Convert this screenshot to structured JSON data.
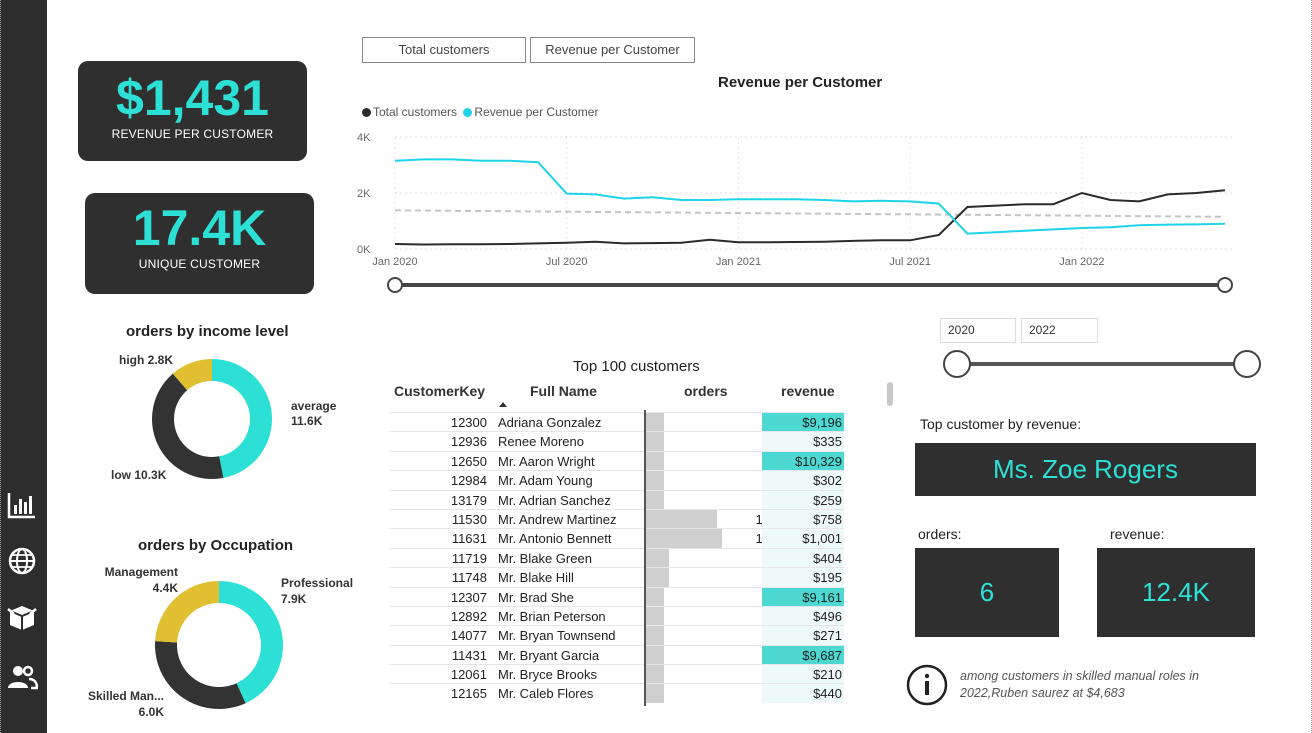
{
  "kpis": {
    "revenue_per_customer": {
      "value": "$1,431",
      "label": "REVENUE PER CUSTOMER"
    },
    "unique_customer": {
      "value": "17.4K",
      "label": "UNIQUE CUSTOMER"
    }
  },
  "toggle_buttons": [
    "Total customers",
    "Revenue per Customer"
  ],
  "line_chart": {
    "title": "Revenue per Customer",
    "legend": [
      "Total customers",
      "Revenue per Customer"
    ],
    "y_ticks": [
      "4K",
      "2K",
      "0K"
    ],
    "x_ticks": [
      "Jan 2020",
      "Jul 2020",
      "Jan 2021",
      "Jul 2021",
      "Jan 2022"
    ]
  },
  "chart_data": {
    "type": "line",
    "x": [
      "2020-01",
      "2020-02",
      "2020-03",
      "2020-04",
      "2020-05",
      "2020-06",
      "2020-07",
      "2020-08",
      "2020-09",
      "2020-10",
      "2020-11",
      "2020-12",
      "2021-01",
      "2021-02",
      "2021-03",
      "2021-04",
      "2021-05",
      "2021-06",
      "2021-07",
      "2021-08",
      "2021-09",
      "2021-10",
      "2021-11",
      "2021-12",
      "2022-01",
      "2022-02",
      "2022-03",
      "2022-04",
      "2022-05",
      "2022-06"
    ],
    "series": [
      {
        "name": "Total customers",
        "color": "#2b2b2b",
        "values": [
          180,
          160,
          170,
          170,
          180,
          200,
          220,
          260,
          200,
          210,
          220,
          330,
          240,
          240,
          250,
          260,
          290,
          310,
          310,
          500,
          1500,
          1550,
          1600,
          1600,
          2000,
          1750,
          1700,
          1950,
          2000,
          2100
        ]
      },
      {
        "name": "Revenue per Customer",
        "color": "#1fd3e8",
        "values": [
          3150,
          3200,
          3200,
          3150,
          3150,
          3100,
          1980,
          1950,
          1800,
          1850,
          1750,
          1750,
          1780,
          1780,
          1780,
          1750,
          1700,
          1720,
          1700,
          1620,
          550,
          600,
          650,
          700,
          750,
          780,
          850,
          870,
          880,
          900
        ]
      }
    ],
    "reference_line": {
      "color": "#c4c4c4",
      "start": 1380,
      "end": 1150
    },
    "ylim": [
      0,
      4000
    ],
    "grid": true,
    "legend_placement": "top-left"
  },
  "date_range": {
    "start": "2020",
    "end": "2022"
  },
  "income_donut": {
    "title": "orders by income level",
    "slices": [
      {
        "label": "average",
        "value": "11.6K",
        "num": 11600,
        "color": "#2de0d6"
      },
      {
        "label": "low",
        "value": "10.3K",
        "num": 10300,
        "color": "#333333"
      },
      {
        "label": "high",
        "value": "2.8K",
        "num": 2800,
        "color": "#e0c030"
      }
    ]
  },
  "occupation_donut": {
    "title": "orders by Occupation",
    "slices": [
      {
        "label": "Professional",
        "value": "7.9K",
        "num": 7900,
        "color": "#2de0d6"
      },
      {
        "label": "Skilled Man...",
        "value": "6.0K",
        "num": 6000,
        "color": "#333333"
      },
      {
        "label": "Management",
        "value": "4.4K",
        "num": 4400,
        "color": "#e0c030"
      }
    ]
  },
  "table": {
    "title": "Top 100 customers",
    "headers": [
      "CustomerKey",
      "Full Name",
      "orders",
      "revenue"
    ],
    "rows": [
      {
        "key": "12300",
        "name": "Adriana Gonzalez",
        "orders": "4",
        "revenue": "$9,196",
        "hi": true
      },
      {
        "key": "12936",
        "name": "Renee Moreno",
        "orders": "4",
        "revenue": "$335",
        "hi": false
      },
      {
        "key": "12650",
        "name": "Mr. Aaron Wright",
        "orders": "4",
        "revenue": "$10,329",
        "hi": true
      },
      {
        "key": "12984",
        "name": "Mr. Adam Young",
        "orders": "4",
        "revenue": "$302",
        "hi": false
      },
      {
        "key": "13179",
        "name": "Mr. Adrian Sanchez",
        "orders": "4",
        "revenue": "$259",
        "hi": false
      },
      {
        "key": "11530",
        "name": "Mr. Andrew Martinez",
        "orders": "15",
        "revenue": "$758",
        "hi": false
      },
      {
        "key": "11631",
        "name": "Mr. Antonio Bennett",
        "orders": "16",
        "revenue": "$1,001",
        "hi": false
      },
      {
        "key": "11719",
        "name": "Mr. Blake Green",
        "orders": "5",
        "revenue": "$404",
        "hi": false
      },
      {
        "key": "11748",
        "name": "Mr. Blake Hill",
        "orders": "5",
        "revenue": "$195",
        "hi": false
      },
      {
        "key": "12307",
        "name": "Mr. Brad She",
        "orders": "4",
        "revenue": "$9,161",
        "hi": true
      },
      {
        "key": "12892",
        "name": "Mr. Brian Peterson",
        "orders": "4",
        "revenue": "$496",
        "hi": false
      },
      {
        "key": "14077",
        "name": "Mr. Bryan Townsend",
        "orders": "4",
        "revenue": "$271",
        "hi": false
      },
      {
        "key": "11431",
        "name": "Mr. Bryant Garcia",
        "orders": "4",
        "revenue": "$9,687",
        "hi": true
      },
      {
        "key": "12061",
        "name": "Mr. Bryce Brooks",
        "orders": "4",
        "revenue": "$210",
        "hi": false
      },
      {
        "key": "12165",
        "name": "Mr. Caleb Flores",
        "orders": "4",
        "revenue": "$440",
        "hi": false
      }
    ]
  },
  "top_customer": {
    "label": "Top customer by revenue:",
    "name": "Ms. Zoe Rogers",
    "orders_label": "orders:",
    "orders_value": "6",
    "revenue_label": "revenue:",
    "revenue_value": "12.4K"
  },
  "info_note": "among customers in skilled manual roles in 2022,Ruben saurez at $4,683",
  "icons": [
    "bar-chart-icon",
    "globe-icon",
    "box-icon",
    "users-icon",
    "info-icon"
  ],
  "colors": {
    "accent": "#2de0d6",
    "dark": "#2f2f2f",
    "gold": "#e0c030"
  }
}
